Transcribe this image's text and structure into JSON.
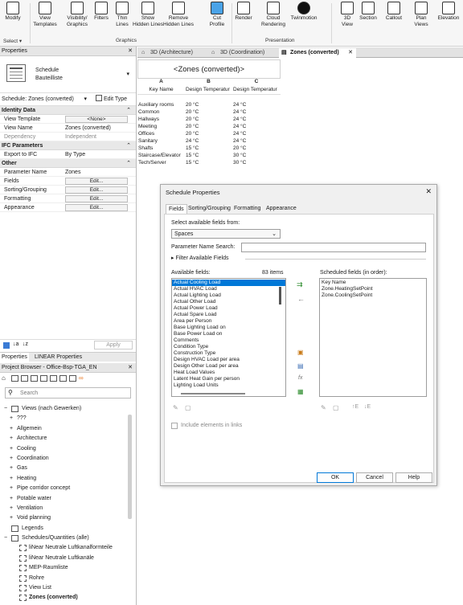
{
  "ribbon": {
    "buttons": [
      {
        "label": "Modify",
        "icon": "cursor-icon"
      },
      {
        "label": "View\nTemplates",
        "icon": "view-templates-icon"
      },
      {
        "label": "Visibility/\nGraphics",
        "icon": "visibility-graphics-icon"
      },
      {
        "label": "Filters",
        "icon": "filters-icon"
      },
      {
        "label": "Thin\nLines",
        "icon": "thin-lines-icon"
      },
      {
        "label": "Show\nHidden Lines",
        "icon": "show-hidden-lines-icon"
      },
      {
        "label": "Remove\nHidden Lines",
        "icon": "remove-hidden-lines-icon"
      },
      {
        "label": "Cut\nProfile",
        "icon": "cut-profile-icon"
      },
      {
        "label": "Render",
        "icon": "render-icon"
      },
      {
        "label": "Cloud\nRendering",
        "icon": "cloud-rendering-icon"
      },
      {
        "label": "Twinmotion",
        "icon": "twinmotion-icon"
      },
      {
        "label": "3D\nView",
        "icon": "3d-view-icon"
      },
      {
        "label": "Section",
        "icon": "section-icon"
      },
      {
        "label": "Callout",
        "icon": "callout-icon"
      },
      {
        "label": "Plan\nViews",
        "icon": "plan-views-icon"
      },
      {
        "label": "Elevation",
        "icon": "elevation-icon"
      }
    ],
    "groups": {
      "select": "Select ▾",
      "graphics": "Graphics",
      "presentation": "Presentation"
    }
  },
  "properties": {
    "title": "Properties",
    "type_line1": "Schedule",
    "type_line2": "Bauteilliste",
    "selector": "Schedule: Zones (converted)",
    "edit_type": "Edit Type",
    "sections": {
      "identity": "Identity Data",
      "ifc": "IFC Parameters",
      "other": "Other"
    },
    "rows": {
      "view_template": {
        "k": "View Template",
        "v": "<None>"
      },
      "view_name": {
        "k": "View Name",
        "v": "Zones (converted)"
      },
      "dependency": {
        "k": "Dependency",
        "v": "Independent"
      },
      "export_ifc": {
        "k": "Export to IFC",
        "v": "By Type"
      },
      "param_name": {
        "k": "Parameter Name",
        "v": "Zones"
      },
      "fields": {
        "k": "Fields",
        "v": "Edit..."
      },
      "sorting": {
        "k": "Sorting/Grouping",
        "v": "Edit..."
      },
      "formatting": {
        "k": "Formatting",
        "v": "Edit..."
      },
      "appearance": {
        "k": "Appearance",
        "v": "Edit..."
      }
    },
    "apply": "Apply",
    "bottom_tabs": [
      "Properties",
      "LINEAR Properties"
    ]
  },
  "browser": {
    "title": "Project Browser - Office-Bsp-TGA_EN",
    "search_placeholder": "Search",
    "items": [
      {
        "label": "Views (nach Gewerken)",
        "exp": "−",
        "indent": 0
      },
      {
        "label": "???",
        "exp": "+",
        "indent": 1
      },
      {
        "label": "Allgemein",
        "exp": "+",
        "indent": 1
      },
      {
        "label": "Architecture",
        "exp": "+",
        "indent": 1
      },
      {
        "label": "Cooling",
        "exp": "+",
        "indent": 1
      },
      {
        "label": "Coordination",
        "exp": "+",
        "indent": 1
      },
      {
        "label": "Gas",
        "exp": "+",
        "indent": 1
      },
      {
        "label": "Heating",
        "exp": "+",
        "indent": 1
      },
      {
        "label": "Pipe corridor concept",
        "exp": "+",
        "indent": 1
      },
      {
        "label": "Potable water",
        "exp": "+",
        "indent": 1
      },
      {
        "label": "Ventilation",
        "exp": "+",
        "indent": 1
      },
      {
        "label": "Void planning",
        "exp": "+",
        "indent": 1
      },
      {
        "label": "Legends",
        "exp": "",
        "indent": 0
      },
      {
        "label": "Schedules/Quantities (alle)",
        "exp": "−",
        "indent": 0
      },
      {
        "label": "liNear Neutrale Luftkanalformteile",
        "exp": "",
        "indent": 2
      },
      {
        "label": "liNear Neutrale Luftkanäle",
        "exp": "",
        "indent": 2
      },
      {
        "label": "MEP-Raumliste",
        "exp": "",
        "indent": 2
      },
      {
        "label": "Rohre",
        "exp": "",
        "indent": 2
      },
      {
        "label": "View List",
        "exp": "",
        "indent": 2
      },
      {
        "label": "Zones (converted)",
        "exp": "",
        "indent": 2,
        "bold": true
      }
    ]
  },
  "tabs": [
    {
      "label": "3D (Architecture)",
      "active": false
    },
    {
      "label": "3D (Coordination)",
      "active": false
    },
    {
      "label": "Zones (converted)",
      "active": true
    }
  ],
  "schedule": {
    "title": "<Zones (converted)>",
    "col_letters": [
      "A",
      "B",
      "C"
    ],
    "headers": [
      "Key Name",
      "Design Temperatur",
      "Design Temperatur"
    ],
    "rows": [
      [
        "Auxiliary rooms",
        "20 °C",
        "24 °C"
      ],
      [
        "Common",
        "20 °C",
        "24 °C"
      ],
      [
        "Hallways",
        "20 °C",
        "24 °C"
      ],
      [
        "Meeting",
        "20 °C",
        "24 °C"
      ],
      [
        "Offices",
        "20 °C",
        "24 °C"
      ],
      [
        "Sanitary",
        "24 °C",
        "24 °C"
      ],
      [
        "Shafts",
        "15 °C",
        "20 °C"
      ],
      [
        "Staircase/Elevator",
        "15 °C",
        "30 °C"
      ],
      [
        "Tech/Server",
        "15 °C",
        "30 °C"
      ]
    ]
  },
  "dialog": {
    "title": "Schedule Properties",
    "tabs": [
      "Fields",
      "Sorting/Grouping",
      "Formatting",
      "Appearance"
    ],
    "select_from_label": "Select available fields from:",
    "select_from_value": "Spaces",
    "param_search_label": "Parameter Name Search:",
    "filter_label": "Filter Available Fields",
    "available_label": "Available fields:",
    "count": "83 items",
    "scheduled_label": "Scheduled fields (in order):",
    "available": [
      "Actual Cooling Load",
      "Actual HVAC Load",
      "Actual Lighting Load",
      "Actual Other Load",
      "Actual Power Load",
      "Actual Spare Load",
      "Area per Person",
      "Base Lighting Load on",
      "Base Power Load on",
      "Comments",
      "Condition Type",
      "Construction Type",
      "Design HVAC Load per area",
      "Design Other Load per area",
      "Heat Load Values",
      "Latent Heat Gain per person",
      "Lighting Load Units"
    ],
    "scheduled": [
      "Key Name",
      "Zone.HeatingSetPoint",
      "Zone.CoolingSetPoint"
    ],
    "include_links": "Include elements in links",
    "ok": "OK",
    "cancel": "Cancel",
    "help": "Help"
  }
}
